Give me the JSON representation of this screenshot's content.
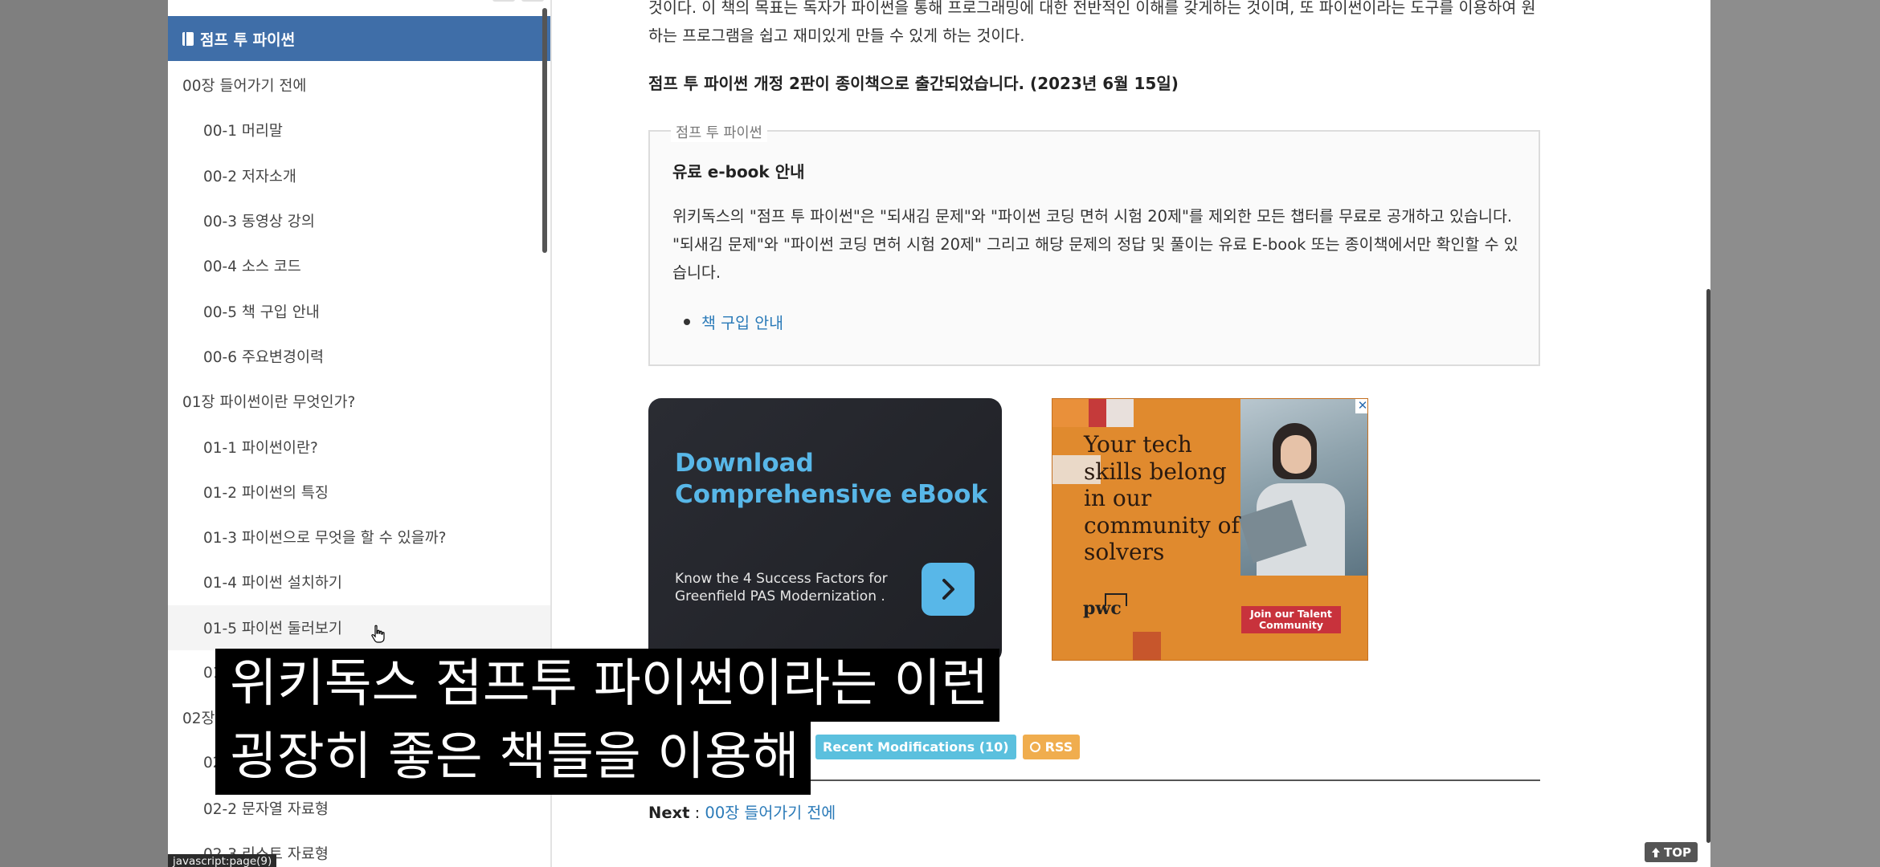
{
  "sidebar": {
    "book_title": "점프 투 파이썬",
    "items": [
      {
        "label": "00장 들어가기 전에",
        "level": 1
      },
      {
        "label": "00-1 머리말",
        "level": 2
      },
      {
        "label": "00-2 저자소개",
        "level": 2
      },
      {
        "label": "00-3 동영상 강의",
        "level": 2
      },
      {
        "label": "00-4 소스 코드",
        "level": 2
      },
      {
        "label": "00-5 책 구입 안내",
        "level": 2
      },
      {
        "label": "00-6 주요변경이력",
        "level": 2
      },
      {
        "label": "01장 파이썬이란 무엇인가?",
        "level": 1
      },
      {
        "label": "01-1 파이썬이란?",
        "level": 2
      },
      {
        "label": "01-2 파이썬의 특징",
        "level": 2
      },
      {
        "label": "01-3 파이썬으로 무엇을 할 수 있을까?",
        "level": 2
      },
      {
        "label": "01-4 파이썬 설치하기",
        "level": 2
      },
      {
        "label": "01-5 파이썬 둘러보기",
        "level": 2
      },
      {
        "label": "01",
        "level": 2
      },
      {
        "label": "02장",
        "level": 1
      },
      {
        "label": "02",
        "level": 2
      },
      {
        "label": "02-2 문자열 자료형",
        "level": 2
      },
      {
        "label": "02-3 리스트 자료형",
        "level": 2
      }
    ],
    "status_url": "javascript:page(9)"
  },
  "content": {
    "intro_text": "것이다. 이 책의 목표는 독자가 파이썬을 통해 프로그래밍에 대한 전반적인 이해를 갖게하는 것이며, 또 파이썬이라는 도구를 이용하여 원하는 프로그램을 쉽고 재미있게 만들 수 있게 하는 것이다.",
    "notice": "점프 투 파이썬 개정 2판이 종이책으로 출간되었습니다. (2023년 6월 15일)",
    "box": {
      "legend": "점프 투 파이썬",
      "title": "유료 e-book 안내",
      "body": "위키독스의 \"점프 투 파이썬\"은 \"되새김 문제\"와 \"파이썬 코딩 면허 시험 20제\"를 제외한 모든 챕터를 무료로 공개하고 있습니다. \"되새김 문제\"와 \"파이썬 코딩 면허 시험 20제\" 그리고 해당 문제의 정답 및 풀이는 유료 E-book 또는 종이책에서만 확인할 수 있습니다.",
      "link": "책 구입 안내"
    },
    "ad1": {
      "title": "Download Comprehensive eBook",
      "subtitle": "Know the 4 Success Factors for Greenfield PAS Modernization .",
      "accent": "#58b7e8"
    },
    "ad2": {
      "headline": "Your tech skills belong in our community of solvers",
      "logo": "pwc",
      "cta": "Join our Talent Community",
      "close": "✕",
      "accent": "#e08a2e"
    },
    "badges": {
      "mods": "Recent Modifications (10)",
      "rss": "RSS"
    },
    "next": {
      "label": "Next",
      "sep": " : ",
      "link": "00장 들어가기 전에"
    },
    "top_button": "TOP"
  },
  "subtitle": {
    "line1": "위키독스 점프투 파이썬이라는 이런",
    "line2": "굉장히 좋은 책들을 이용해"
  },
  "colors": {
    "sidebar_header": "#3f6ea8",
    "link": "#2a7ab8",
    "badge_blue": "#5bc0de",
    "badge_orange": "#f0ad4e"
  }
}
